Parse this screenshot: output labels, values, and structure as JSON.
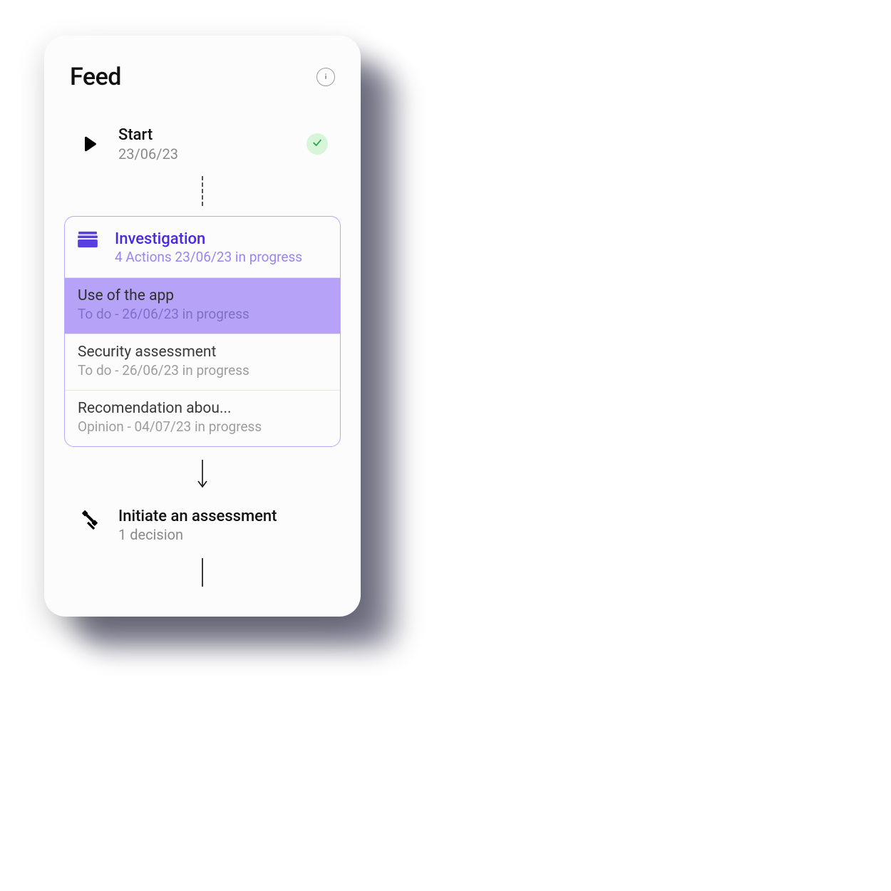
{
  "header": {
    "title": "Feed"
  },
  "start": {
    "title": "Start",
    "date": "23/06/23",
    "status": "done"
  },
  "investigation": {
    "title": "Investigation",
    "sub": "4 Actions 23/06/23 in progress",
    "tasks": [
      {
        "title": "Use of the app",
        "sub": "To do - 26/06/23 in progress",
        "selected": true
      },
      {
        "title": "Security assessment",
        "sub": "To do - 26/06/23 in progress",
        "selected": false
      },
      {
        "title": "Recomendation abou...",
        "sub": "Opinion - 04/07/23 in progress",
        "selected": false
      }
    ]
  },
  "assessment": {
    "title": "Initiate an assessment",
    "sub": "1 decision"
  },
  "colors": {
    "accent": "#5a3fe0",
    "taskSelectedBg": "#b6a3f8",
    "successBg": "#d7f5d9",
    "success": "#25a244"
  }
}
